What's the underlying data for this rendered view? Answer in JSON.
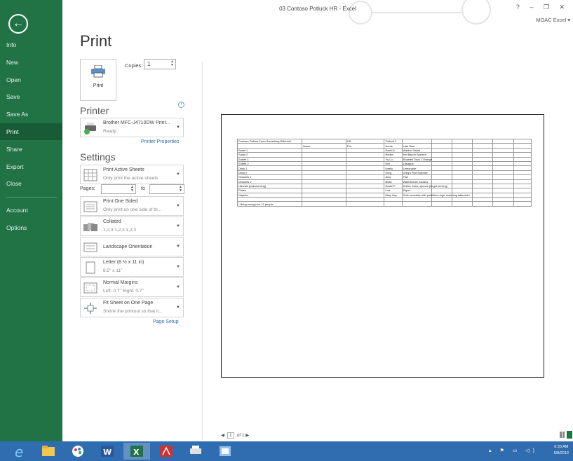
{
  "window": {
    "title": "03 Contoso Potluck HR - Excel",
    "controls": "? – ❐ ✕",
    "account": "MOAC Excel ▾"
  },
  "sidebar": {
    "items": [
      {
        "label": "Info"
      },
      {
        "label": "New"
      },
      {
        "label": "Open"
      },
      {
        "label": "Save"
      },
      {
        "label": "Save As"
      },
      {
        "label": "Print",
        "active": true
      },
      {
        "label": "Share"
      },
      {
        "label": "Export"
      },
      {
        "label": "Close"
      },
      {
        "label": "Account"
      },
      {
        "label": "Options"
      }
    ]
  },
  "print": {
    "heading": "Print",
    "button_label": "Print",
    "copies_label": "Copies:",
    "copies_value": "1"
  },
  "printer": {
    "heading": "Printer",
    "name": "Brother MFC-J4710DW Print...",
    "status": "Ready",
    "properties_link": "Printer Properties"
  },
  "settings": {
    "heading": "Settings",
    "sheets": {
      "title": "Print Active Sheets",
      "desc": "Only print the active sheets"
    },
    "pages_label": "Pages:",
    "to_label": "to",
    "sided": {
      "title": "Print One Sided",
      "desc": "Only print on one side of th..."
    },
    "collated": {
      "title": "Collated",
      "desc": "1,2,3   1,2,3   1,2,3"
    },
    "orientation": {
      "title": "Landscape Orientation"
    },
    "paper": {
      "title": "Letter (8 ½ x 11 in)",
      "desc": "8.5\" x 11\""
    },
    "margins": {
      "title": "Normal Margins",
      "desc": "Left: 0.7\"   Right: 0.7\""
    },
    "scaling": {
      "title": "Fit Sheet on One Page",
      "desc": "Shrink the printout so that it..."
    },
    "page_setup_link": "Page Setup"
  },
  "sheet_rows": [
    [
      "Contoso Potluck Form-Something Different!",
      "",
      "HR",
      "Potluck 1",
      "",
      "",
      "",
      "",
      "",
      ""
    ],
    [
      "",
      "Name",
      "Ext",
      "Name",
      "Last Time",
      "",
      "",
      "",
      "",
      ""
    ],
    [
      "Salad 1",
      "",
      "",
      "David A.",
      "Waldorf Salad",
      "",
      "",
      "",
      "",
      ""
    ],
    [
      "Salad 2",
      "",
      "",
      "Hedim",
      "Hot Bacon Spinach",
      "",
      "",
      "",
      "",
      ""
    ],
    [
      "Entrée 1",
      "",
      "",
      "Yu-Lo",
      "Roasted Duck L'Orange",
      "",
      "",
      "",
      "",
      ""
    ],
    [
      "Entrée 2",
      "",
      "",
      "Kim",
      "Lasagna",
      "",
      "",
      "",
      "",
      ""
    ],
    [
      "Drink 1",
      "",
      "",
      "Kwelu",
      "Lemonade",
      "",
      "",
      "",
      "",
      ""
    ],
    [
      "Drink 2",
      "",
      "",
      "Greg",
      "Greg's Red Surprise",
      "",
      "",
      "",
      "",
      ""
    ],
    [
      "Desserts 1",
      "",
      "",
      "Amy",
      "Flan",
      "",
      "",
      "",
      "",
      ""
    ],
    [
      "Desserts 2",
      "",
      "",
      "Brian",
      "Watertorture cookies",
      "",
      "",
      "",
      "",
      ""
    ],
    [
      "Utensils (indiv/serving)",
      "",
      "",
      "David P.",
      "Knifes, forks, spoons (forgot serving)",
      "",
      "",
      "",
      "",
      ""
    ],
    [
      "Plates",
      "",
      "",
      "Luiz",
      "Paper",
      "",
      "",
      "",
      "",
      ""
    ],
    [
      "Napkins",
      "",
      "",
      "Mary Kay",
      "Cloth reusable with pink/blue rings; matching tablecloth",
      "",
      "",
      "",
      "",
      ""
    ],
    [
      "",
      "",
      "",
      "",
      "",
      "",
      "",
      "",
      "",
      ""
    ],
    [
      "* Bring enough for 12 people",
      "",
      "",
      "",
      "",
      "",
      "",
      "",
      "",
      ""
    ]
  ],
  "pager": {
    "prev": "◀",
    "page": "1",
    "of": "of 1",
    "next": "▶"
  },
  "taskbar": {
    "tray_icons": "▴ ⚑ ▭ ◁)",
    "time": "6:33 AM",
    "date": "5/8/2013"
  },
  "colors": {
    "accent": "#217346",
    "taskbar": "#2f6db0",
    "link": "#2e6ea8"
  }
}
